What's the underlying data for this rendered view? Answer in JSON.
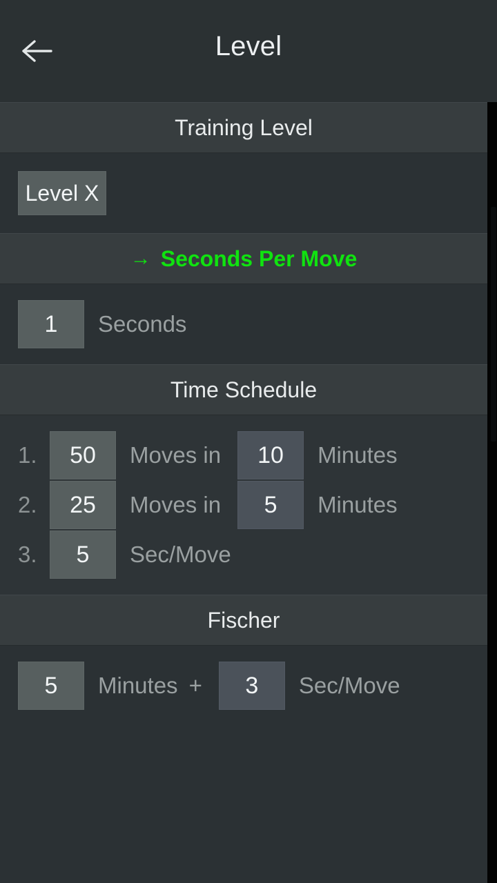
{
  "header": {
    "back_icon": "arrow-left-icon",
    "title": "Level"
  },
  "sections": {
    "training": {
      "title": "Training Level",
      "level_button": "Level X"
    },
    "seconds_per_move": {
      "title": "Seconds Per Move",
      "arrow_glyph": "→",
      "value": "1",
      "label": "Seconds",
      "accent_color": "#10e310"
    },
    "time_schedule": {
      "title": "Time Schedule",
      "rows": [
        {
          "index": "1.",
          "moves": "50",
          "moves_label": "Moves in",
          "time": "10",
          "time_label": "Minutes"
        },
        {
          "index": "2.",
          "moves": "25",
          "moves_label": "Moves in",
          "time": "5",
          "time_label": "Minutes"
        },
        {
          "index": "3.",
          "moves": "5",
          "moves_label": "Sec/Move",
          "time": "",
          "time_label": ""
        }
      ]
    },
    "fischer": {
      "title": "Fischer",
      "minutes": "5",
      "minutes_label": "Minutes",
      "plus": "+",
      "increment": "3",
      "increment_label": "Sec/Move"
    }
  },
  "colors": {
    "background": "#2b3134",
    "section_header": "#373d3f",
    "chip": "#575f5f",
    "chip_blue": "#4b525a",
    "accent": "#10e310",
    "label_text": "#9aa0a1",
    "value_text": "#f2f5f6"
  }
}
